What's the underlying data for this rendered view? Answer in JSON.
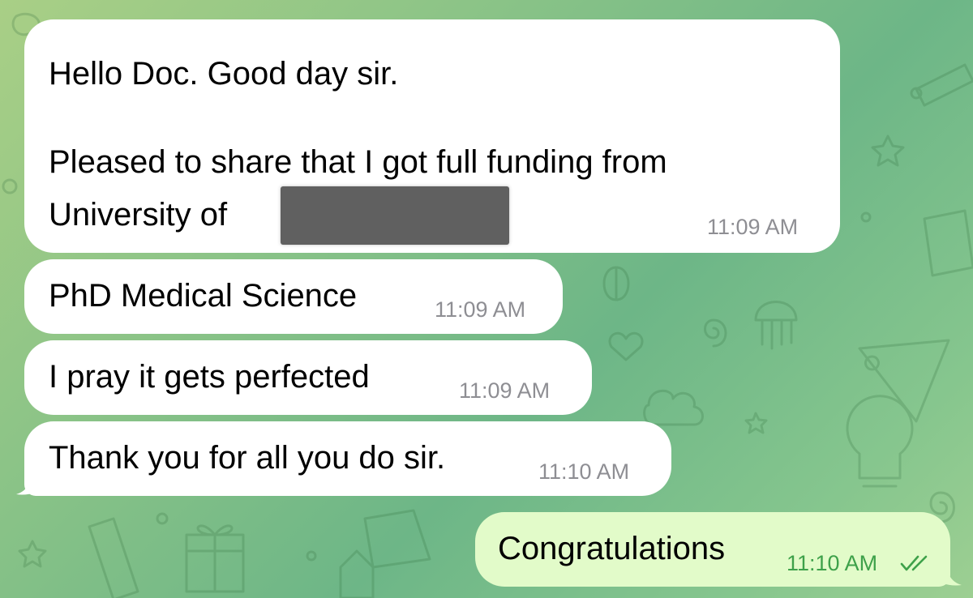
{
  "colors": {
    "incoming_bubble": "#ffffff",
    "outgoing_bubble": "#e2fbc9",
    "incoming_time": "#8e8e93",
    "outgoing_time": "#3ea14a",
    "background": "#8cc487"
  },
  "messages": [
    {
      "direction": "incoming",
      "lines": [
        "Hello Doc. Good day sir.",
        "",
        "Pleased to share that I got full funding from",
        "University of"
      ],
      "redacted": true,
      "time": "11:09 AM"
    },
    {
      "direction": "incoming",
      "text": "PhD Medical Science",
      "time": "11:09 AM"
    },
    {
      "direction": "incoming",
      "text": "I pray it gets perfected",
      "time": "11:09 AM"
    },
    {
      "direction": "incoming",
      "text": "Thank you for all you do sir.",
      "time": "11:10 AM"
    },
    {
      "direction": "outgoing",
      "text": "Congratulations",
      "time": "11:10 AM",
      "status_icon": "double-check-icon",
      "status": "read"
    }
  ]
}
